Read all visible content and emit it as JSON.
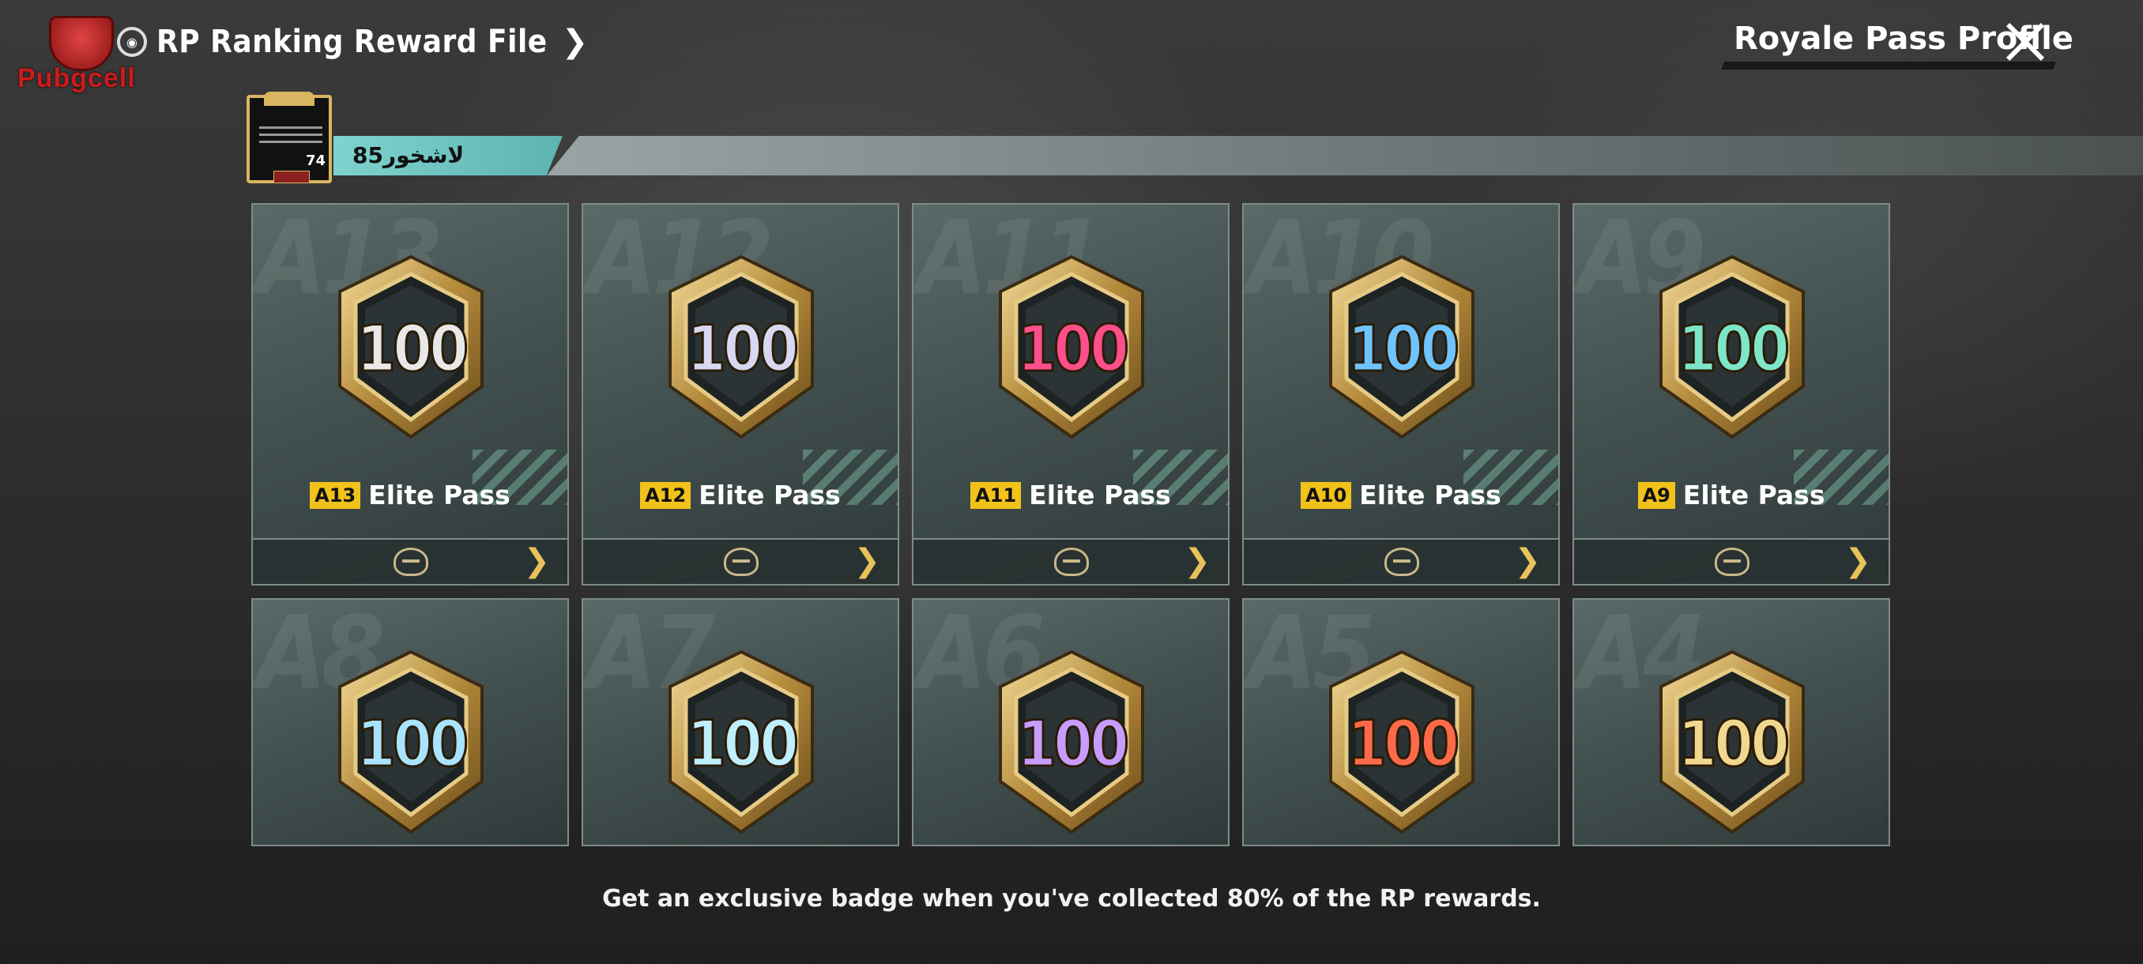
{
  "watermark": {
    "text": "Pubgcell"
  },
  "header": {
    "title": "RP Ranking Reward File",
    "profile_link": "Royale Pass Profile"
  },
  "player": {
    "name": "لاشخور85",
    "level": "74"
  },
  "row1": [
    {
      "season": "A13",
      "chip": "A13",
      "label": "Elite Pass",
      "value": "100",
      "color": "#e8e8e8"
    },
    {
      "season": "A12",
      "chip": "A12",
      "label": "Elite Pass",
      "value": "100",
      "color": "#d8d8f0"
    },
    {
      "season": "A11",
      "chip": "A11",
      "label": "Elite Pass",
      "value": "100",
      "color": "#ff4f8a"
    },
    {
      "season": "A10",
      "chip": "A10",
      "label": "Elite Pass",
      "value": "100",
      "color": "#6fc4ff"
    },
    {
      "season": "A9",
      "chip": "A9",
      "label": "Elite Pass",
      "value": "100",
      "color": "#7ee6c8"
    }
  ],
  "row2": [
    {
      "season": "A8",
      "value": "100",
      "color": "#a8e4ff"
    },
    {
      "season": "A7",
      "value": "100",
      "color": "#bfefff"
    },
    {
      "season": "A6",
      "value": "100",
      "color": "#c89cff"
    },
    {
      "season": "A5",
      "value": "100",
      "color": "#ff6a4a"
    },
    {
      "season": "A4",
      "value": "100",
      "color": "#f0d890"
    }
  ],
  "hint": "Get an exclusive badge when you've collected 80% of the RP rewards."
}
